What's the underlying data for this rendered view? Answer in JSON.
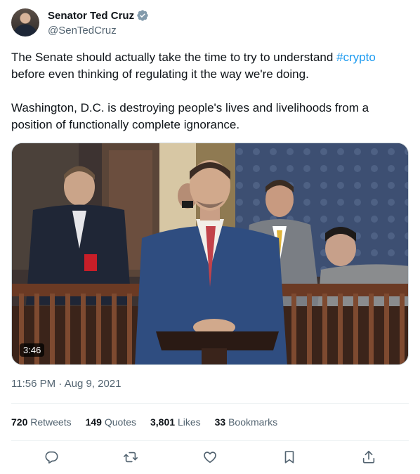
{
  "author": {
    "name": "Senator Ted Cruz",
    "handle": "@SenTedCruz",
    "verified_color": "#829aab"
  },
  "tweet": {
    "text_line1_before": "The Senate should actually take the time to try to understand ",
    "hashtag": "#crypto",
    "text_line1_after": " before even thinking of regulating it the way we're doing.",
    "text_para2": "Washington, D.C. is destroying people's lives and livelihoods from a position of functionally complete ignorance."
  },
  "media": {
    "type": "video",
    "duration": "3:46"
  },
  "meta": {
    "timestamp": "11:56 PM · Aug 9, 2021"
  },
  "stats": {
    "retweets_count": "720",
    "retweets_label": "Retweets",
    "quotes_count": "149",
    "quotes_label": "Quotes",
    "likes_count": "3,801",
    "likes_label": "Likes",
    "bookmarks_count": "33",
    "bookmarks_label": "Bookmarks"
  },
  "actions": [
    "reply-icon",
    "retweet-icon",
    "like-icon",
    "bookmark-icon",
    "share-icon"
  ],
  "colors": {
    "link": "#1d9bf0",
    "secondary_text": "#536471",
    "icon": "#536471"
  }
}
